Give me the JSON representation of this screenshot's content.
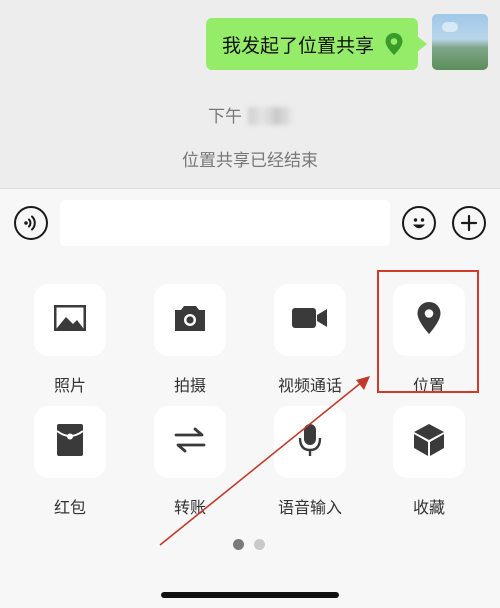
{
  "chat": {
    "message_text": "我发起了位置共享",
    "message_icon": "location-pin-icon",
    "timestamp": "下午",
    "system_message": "位置共享已经结束"
  },
  "input_bar": {
    "voice_icon": "voice-icon",
    "text_value": "",
    "emoji_icon": "emoji-icon",
    "plus_icon": "plus-icon"
  },
  "panel": {
    "items": [
      {
        "label": "照片",
        "icon": "photo-icon"
      },
      {
        "label": "拍摄",
        "icon": "camera-icon"
      },
      {
        "label": "视频通话",
        "icon": "video-call-icon"
      },
      {
        "label": "位置",
        "icon": "location-icon"
      },
      {
        "label": "红包",
        "icon": "red-packet-icon"
      },
      {
        "label": "转账",
        "icon": "transfer-icon"
      },
      {
        "label": "语音输入",
        "icon": "microphone-icon"
      },
      {
        "label": "收藏",
        "icon": "favorites-icon"
      }
    ],
    "page_count": 2,
    "current_page": 1
  },
  "colors": {
    "bubble_green": "#95ec69",
    "highlight_red": "#d23a2a",
    "background": "#ededed"
  }
}
